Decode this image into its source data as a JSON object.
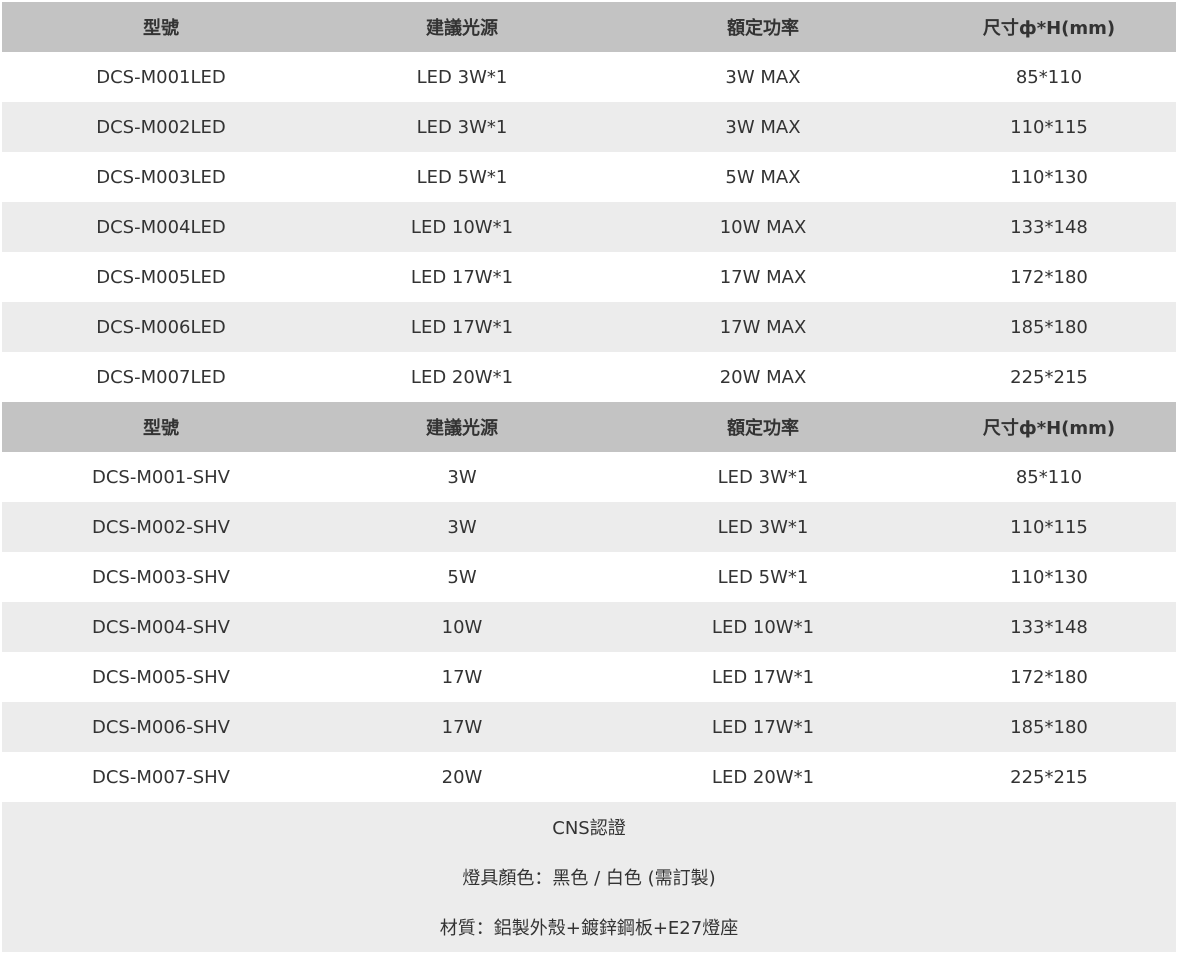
{
  "section_led": {
    "headers": [
      "型號",
      "建議光源",
      "額定功率",
      "尺寸ф*H(mm)"
    ],
    "rows": [
      [
        "DCS-M001LED",
        "LED 3W*1",
        "3W MAX",
        "85*110"
      ],
      [
        "DCS-M002LED",
        "LED 3W*1",
        "3W MAX",
        "110*115"
      ],
      [
        "DCS-M003LED",
        "LED 5W*1",
        "5W MAX",
        "110*130"
      ],
      [
        "DCS-M004LED",
        "LED 10W*1",
        "10W MAX",
        "133*148"
      ],
      [
        "DCS-M005LED",
        "LED 17W*1",
        "17W MAX",
        "172*180"
      ],
      [
        "DCS-M006LED",
        "LED 17W*1",
        "17W MAX",
        "185*180"
      ],
      [
        "DCS-M007LED",
        "LED 20W*1",
        "20W MAX",
        "225*215"
      ]
    ]
  },
  "section_shv": {
    "headers": [
      "型號",
      "建議光源",
      "額定功率",
      "尺寸ф*H(mm)"
    ],
    "rows": [
      [
        "DCS-M001-SHV",
        "3W",
        "LED 3W*1",
        "85*110"
      ],
      [
        "DCS-M002-SHV",
        "3W",
        "LED 3W*1",
        "110*115"
      ],
      [
        "DCS-M003-SHV",
        "5W",
        "LED 5W*1",
        "110*130"
      ],
      [
        "DCS-M004-SHV",
        "10W",
        "LED 10W*1",
        "133*148"
      ],
      [
        "DCS-M005-SHV",
        "17W",
        "LED 17W*1",
        "172*180"
      ],
      [
        "DCS-M006-SHV",
        "17W",
        "LED 17W*1",
        "185*180"
      ],
      [
        "DCS-M007-SHV",
        "20W",
        "LED 20W*1",
        "225*215"
      ]
    ]
  },
  "notes": [
    "CNS認證",
    "燈具顏色：黑色 / 白色 (需訂製)",
    "材質：鋁製外殼+鍍鋅鋼板+E27燈座"
  ],
  "colors": {
    "header_bg": "#c3c3c3",
    "alt_row_bg": "#ececec",
    "text": "#333333"
  }
}
